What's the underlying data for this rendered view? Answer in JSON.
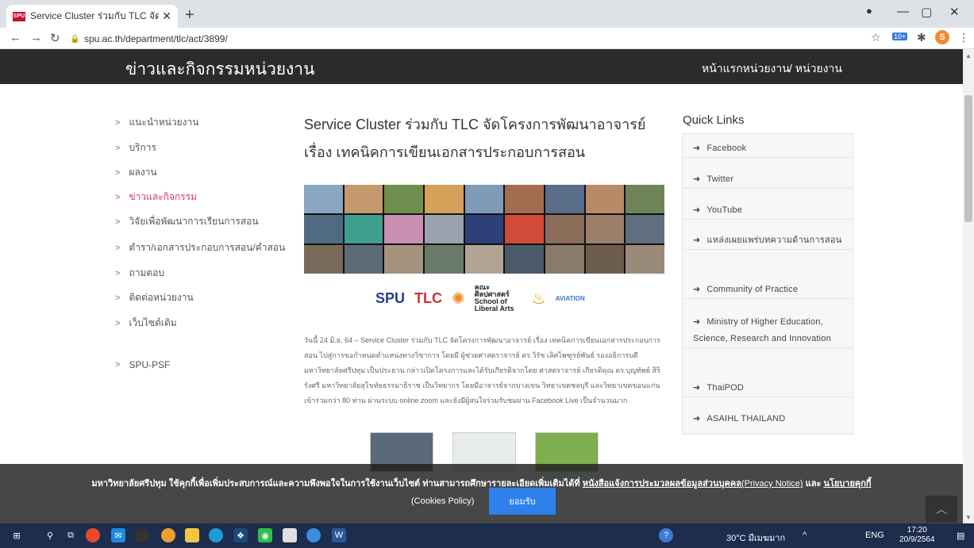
{
  "browser": {
    "tab_title": "Service Cluster ร่วมกับ TLC จัดโครง",
    "tab_favicon": "SPU",
    "url": "spu.ac.th/department/tlc/act/3899/",
    "profile_initial": "S",
    "ext_badge": "10+"
  },
  "header": {
    "title": "ข่าวและกิจกรรมหน่วยงาน",
    "crumb_home": "หน้าแรกหน่วยงาน",
    "crumb_sep_label": "/ หน่วยงาน"
  },
  "sidebar": {
    "items": [
      {
        "label": "แนะนำหน่วยงาน"
      },
      {
        "label": "บริการ"
      },
      {
        "label": "ผลงาน"
      },
      {
        "label": "ข่าวและกิจกรรม"
      },
      {
        "label": "วิจัยเพื่อพัฒนาการเรียนการสอน"
      },
      {
        "label": "ตำรา/เอกสารประกอบการสอน/คำสอน"
      },
      {
        "label": "ถามตอบ"
      },
      {
        "label": "ติดต่อหน่วยงาน"
      },
      {
        "label": "เว็บไซต์เดิม"
      },
      {
        "label": "SPU-PSF"
      }
    ],
    "active_index": 3
  },
  "article": {
    "title": "Service Cluster ร่วมกับ TLC จัดโครงการพัฒนาอาจารย์ เรื่อง เทคนิคการเขียนเอกสารประกอบการสอน",
    "logos": {
      "spu": "SPU",
      "tlc": "TLC",
      "la": "คณะศิลปศาสตร์ School of Liberal Arts",
      "aviation": "AVIATION"
    },
    "body": "วันนี้ 24 มิ.ย. 64 – Service Cluster ร่วมกับ TLC จัดโครงการพัฒนาอาจารย์ เรื่อง เทคนิคการเขียนเอกสารประกอบการสอน ไปสู่การขอกำหนดตำแหน่งทางวิชาการ โดยมี ผู้ช่วยศาสตราจารย์ ดร.วิรัช เลิศไพฑูรย์พันธ์ รองอธิการบดี มหาวิทยาลัยศรีปทุม เป็นประธาน กล่าวเปิดโครงการและได้รับเกียรติจากโดย ศาสตราจารย์ เกียรติคุณ ดร.บุญทัพย์ สิริรังศรี มหาวิทยาลัยสุโขทัยธรรมาธิราช เป็นวิทยากร โดยมีอาจารย์จากบางเขน วิทยาเขตชลบุรี และวิทยาเขตขอนแก่น เข้าร่วมกว่า 80 ท่าน ผ่านระบบ online zoom และยังมีผู้สนใจร่วมรับชมผ่าน Facebook Live เป็นจำนวนมาก"
  },
  "quick_links": {
    "title": "Quick Links",
    "items": [
      {
        "label": "Facebook"
      },
      {
        "label": "Twitter"
      },
      {
        "label": "YouTube"
      },
      {
        "label": "แหล่งเผยแพร่บทความด้านการสอน"
      },
      {
        "label": "Community of Practice"
      },
      {
        "label": "Ministry of Higher Education, Science, Research and Innovation"
      },
      {
        "label": "ThaiPOD"
      },
      {
        "label": "ASAIHL THAILAND"
      }
    ]
  },
  "cookie": {
    "text_main": "มหาวิทยาลัยศรีปทุม ใช้คุกกี้เพื่อเพิ่มประสบการณ์และความพึงพอใจในการใช้งานเว็บไซต์ ท่านสามารถศึกษารายละเอียดเพิ่มเติมได้ที่",
    "link_notice": "หนังสือแจ้งการประมวลผลข้อมูลส่วนบุคคล",
    "link_notice_en": "(Privacy Notice)",
    "and_text": "และ",
    "link_policy": "นโยบายคุกกี้",
    "policy_en": "(Cookies Policy)",
    "accept": "ยอมรับ"
  },
  "taskbar": {
    "weather": "30°C มีเมฆมาก",
    "lang": "ENG",
    "time": "17:20",
    "date": "20/9/2564"
  }
}
